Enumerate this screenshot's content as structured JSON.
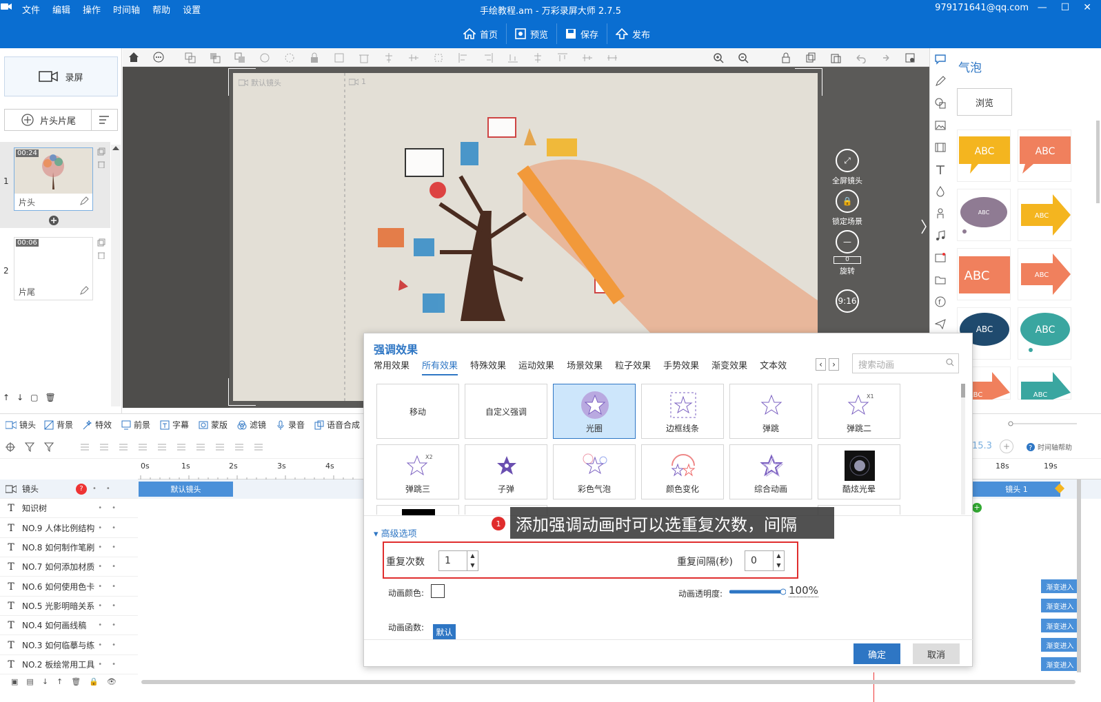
{
  "window": {
    "title": "手绘教程.am - 万彩录屏大师 2.7.5",
    "account": "979171641@qq.com",
    "menu": [
      "文件",
      "编辑",
      "操作",
      "时间轴",
      "帮助",
      "设置"
    ]
  },
  "main_toolbar": [
    {
      "label": "首页",
      "icon": "home-icon"
    },
    {
      "label": "预览",
      "icon": "preview-icon"
    },
    {
      "label": "保存",
      "icon": "save-icon"
    },
    {
      "label": "发布",
      "icon": "publish-icon"
    }
  ],
  "left_panel": {
    "record_label": "录屏",
    "head_tail_label": "片头片尾",
    "scenes": [
      {
        "num": "1",
        "duration": "00:24",
        "label": "片头"
      },
      {
        "num": "2",
        "duration": "00:06",
        "label": "片尾"
      }
    ]
  },
  "canvas": {
    "camera_default_label": "默认镜头",
    "camera_1_label": "1",
    "side_buttons": [
      {
        "label": "全屏镜头"
      },
      {
        "label": "锁定场景"
      },
      {
        "label": "旋转",
        "value": "0"
      },
      {
        "label": "",
        "value": "9:16"
      }
    ]
  },
  "bubble_panel": {
    "title": "气泡",
    "browse_label": "浏览",
    "bubbles": [
      {
        "text": "ABC",
        "color": "#f4b51f"
      },
      {
        "text": "ABC",
        "color": "#f0805d"
      },
      {
        "text": "ABC",
        "color": "#8f7b93"
      },
      {
        "text": "ABC",
        "color": "#f4b51f"
      },
      {
        "text": "ABC",
        "color": "#f0805d"
      },
      {
        "text": "ABC",
        "color": "#f0805d"
      },
      {
        "text": "ABC",
        "color": "#1f4a6e"
      },
      {
        "text": "ABC",
        "color": "#3aa6a0"
      },
      {
        "text": "ABC",
        "color": "#f0805d"
      },
      {
        "text": "ABC",
        "color": "#3aa6a0"
      }
    ]
  },
  "track_bar": [
    "镜头",
    "背景",
    "特效",
    "前景",
    "字幕",
    "蒙版",
    "滤镜",
    "录音",
    "语音合成"
  ],
  "timeline": {
    "ticks": [
      "0s",
      "1s",
      "2s",
      "3s",
      "4s",
      "18s",
      "19s"
    ],
    "zoom_value": "15.3",
    "help_label": "时间轴帮助",
    "rows": [
      {
        "label": "镜头",
        "type": "camera"
      },
      {
        "label": "知识树",
        "type": "text"
      },
      {
        "label": "NO.9 人体比例结构",
        "type": "text"
      },
      {
        "label": "NO.8 如何制作笔刷",
        "type": "text"
      },
      {
        "label": "NO.7 如何添加材质",
        "type": "text"
      },
      {
        "label": "NO.6 如何使用色卡",
        "type": "text"
      },
      {
        "label": "NO.5 光影明暗关系",
        "type": "text"
      },
      {
        "label": "NO.4 如何画线稿",
        "type": "text"
      },
      {
        "label": "NO.3 如何临摹与练",
        "type": "text"
      },
      {
        "label": "NO.2 板绘常用工具",
        "type": "text"
      }
    ],
    "default_camera_block": "默认镜头",
    "camera1_block": "镜头 1",
    "transition_label": "渐变进入"
  },
  "dialog": {
    "title": "强调效果",
    "tabs": [
      "常用效果",
      "所有效果",
      "特殊效果",
      "运动效果",
      "场景效果",
      "粒子效果",
      "手势效果",
      "渐变效果",
      "文本效"
    ],
    "active_tab": "所有效果",
    "search_placeholder": "搜索动画",
    "effects": [
      "移动",
      "自定义强调",
      "光圈",
      "边框线条",
      "弹跳",
      "弹跳二",
      "弹跳三",
      "子弹",
      "彩色气泡",
      "颜色变化",
      "综合动画",
      "酷炫光晕"
    ],
    "selected_effect": "光圈",
    "advanced_label": "高级选项",
    "repeat_count_label": "重复次数",
    "repeat_count_value": "1",
    "repeat_interval_label": "重复间隔(秒)",
    "repeat_interval_value": "0",
    "anim_color_label": "动画颜色:",
    "anim_opacity_label": "动画透明度:",
    "anim_opacity_value": "100%",
    "anim_func_label": "动画函数:",
    "anim_func_value": "默认",
    "ok_label": "确定",
    "cancel_label": "取消"
  },
  "tooltip": {
    "number": "1",
    "text": "添加强调动画时可以选重复次数，间隔"
  },
  "colors": {
    "brand": "#0a6ed1",
    "accent": "#2e76c4",
    "highlight": "#e02d2d"
  }
}
